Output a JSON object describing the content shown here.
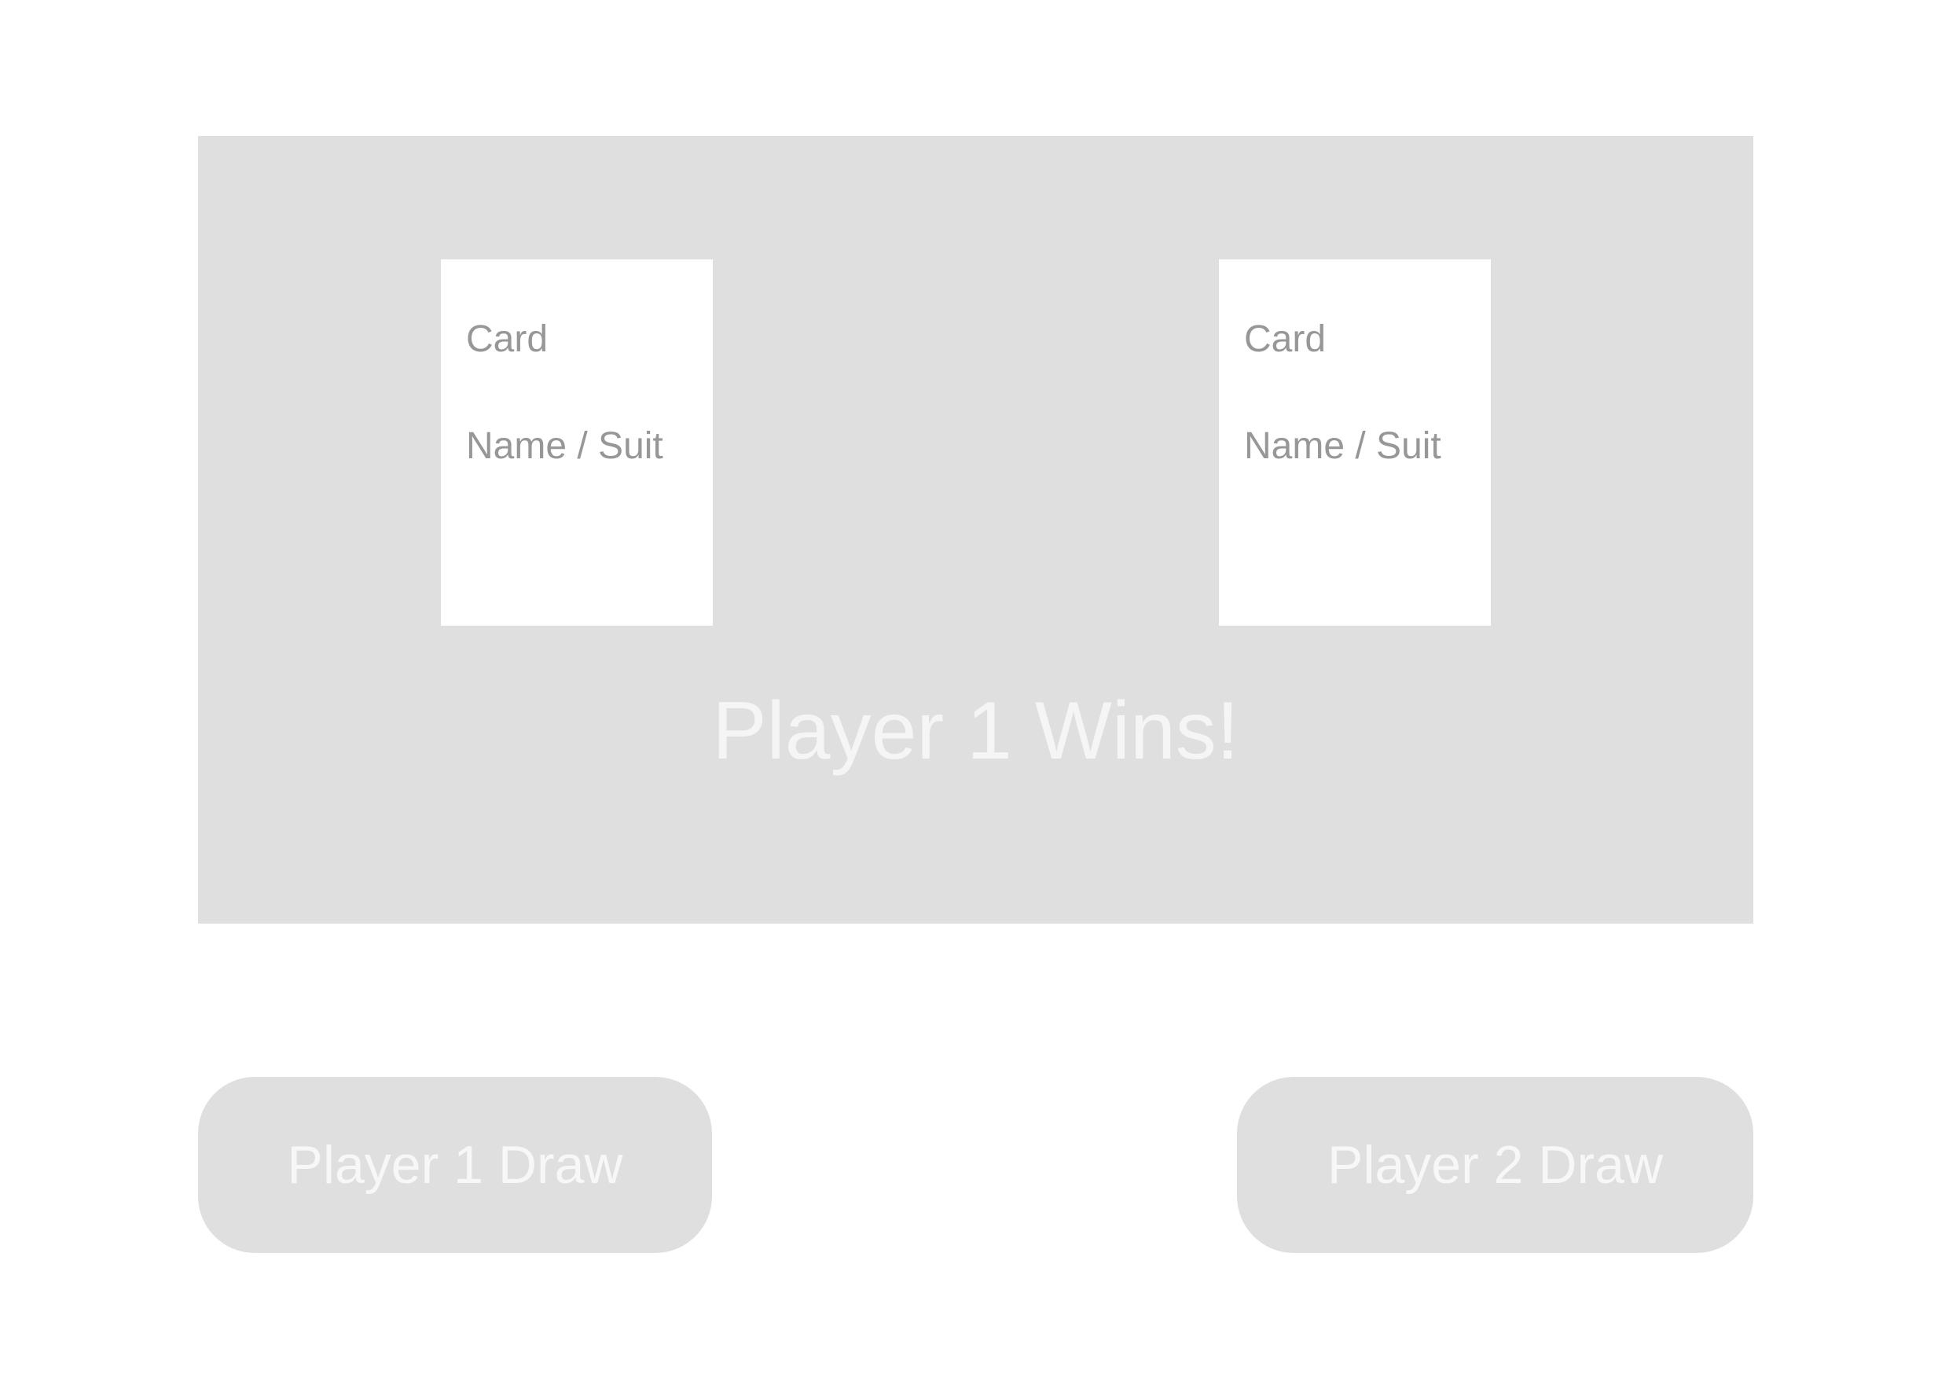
{
  "board": {
    "cards": [
      {
        "title": "Card",
        "subtitle": "Name / Suit"
      },
      {
        "title": "Card",
        "subtitle": "Name / Suit"
      }
    ],
    "result_text": "Player 1 Wins!"
  },
  "controls": {
    "player1_draw_label": "Player 1 Draw",
    "player2_draw_label": "Player 2 Draw"
  },
  "colors": {
    "board_background": "#dfdfdf",
    "card_background": "#ffffff",
    "card_text": "#979797",
    "result_text": "#f5f5f5",
    "button_background": "#dfdfdf",
    "button_text": "#f7f7f7"
  }
}
